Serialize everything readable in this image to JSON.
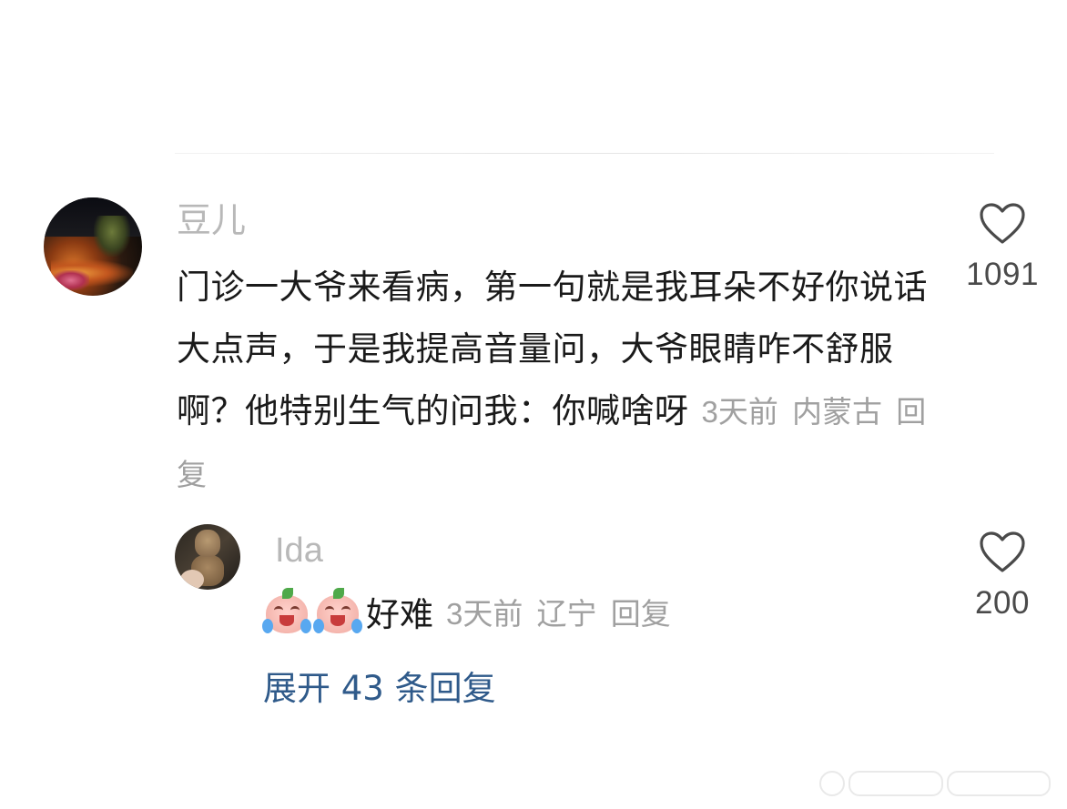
{
  "comment": {
    "username": "豆儿",
    "text": "门诊一大爷来看病，第一句就是我耳朵不好你说话大点声，于是我提高音量问，大爷眼睛咋不舒服啊？他特别生气的问我：你喊啥呀",
    "time": "3天前",
    "location": "内蒙古",
    "reply_label": "回复",
    "likes": "1091",
    "icons": {
      "like": "heart-outline-icon",
      "avatar": "night-scene-avatar"
    }
  },
  "reply": {
    "username": "Ida",
    "emojis": [
      "crying-peach-emoji",
      "crying-peach-emoji"
    ],
    "text": "好难",
    "time": "3天前",
    "location": "辽宁",
    "reply_label": "回复",
    "likes": "200",
    "icons": {
      "like": "heart-outline-icon",
      "avatar": "groot-toy-avatar"
    }
  },
  "expand_replies": "展开 43 条回复",
  "colors": {
    "username": "#b8b8b8",
    "body_text": "#1a1a1a",
    "meta_text": "#a0a0a0",
    "link_blue": "#2f5a8a",
    "heart_stroke": "#4a4a4a"
  }
}
